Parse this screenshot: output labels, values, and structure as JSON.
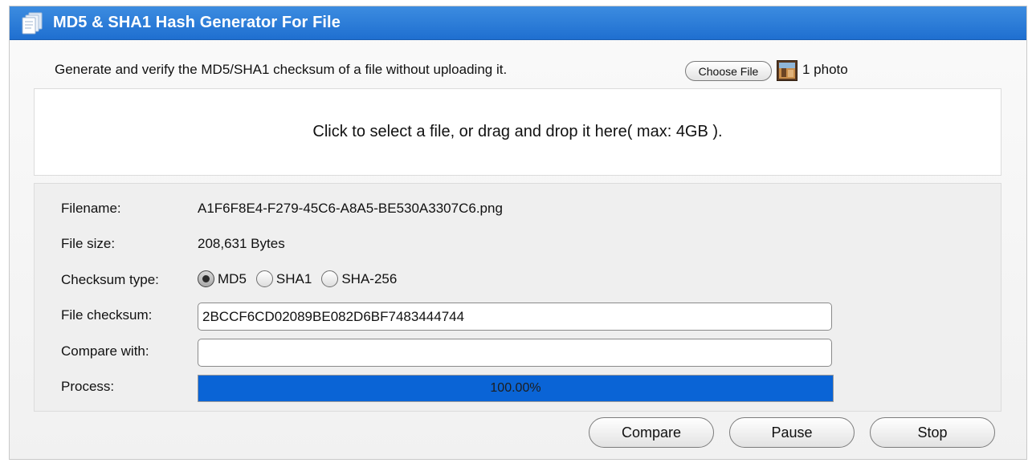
{
  "header": {
    "title": "MD5 & SHA1 Hash Generator For File",
    "icon": "document-stack-icon"
  },
  "intro": {
    "description": "Generate and verify the MD5/SHA1 checksum of a file without uploading it.",
    "choose_file_label": "Choose File",
    "selected_files_label": "1 photo"
  },
  "dropzone": {
    "text": "Click to select a file, or drag and drop it here( max: 4GB )."
  },
  "details": {
    "filename_label": "Filename:",
    "filename_value": "A1F6F8E4-F279-45C6-A8A5-BE530A3307C6.png",
    "filesize_label": "File size:",
    "filesize_value": "208,631 Bytes",
    "checksum_type_label": "Checksum type:",
    "checksum_types": [
      "MD5",
      "SHA1",
      "SHA-256"
    ],
    "checksum_type_selected": "MD5",
    "file_checksum_label": "File checksum:",
    "file_checksum_value": "2BCCF6CD02089BE082D6BF7483444744",
    "compare_label": "Compare with:",
    "compare_value": "",
    "process_label": "Process:",
    "process_text": "100.00%",
    "process_fraction": 1.0
  },
  "actions": {
    "compare": "Compare",
    "pause": "Pause",
    "stop": "Stop"
  },
  "colors": {
    "title_bar": "#1f6fd0",
    "progress_fill": "#0a64d6"
  }
}
